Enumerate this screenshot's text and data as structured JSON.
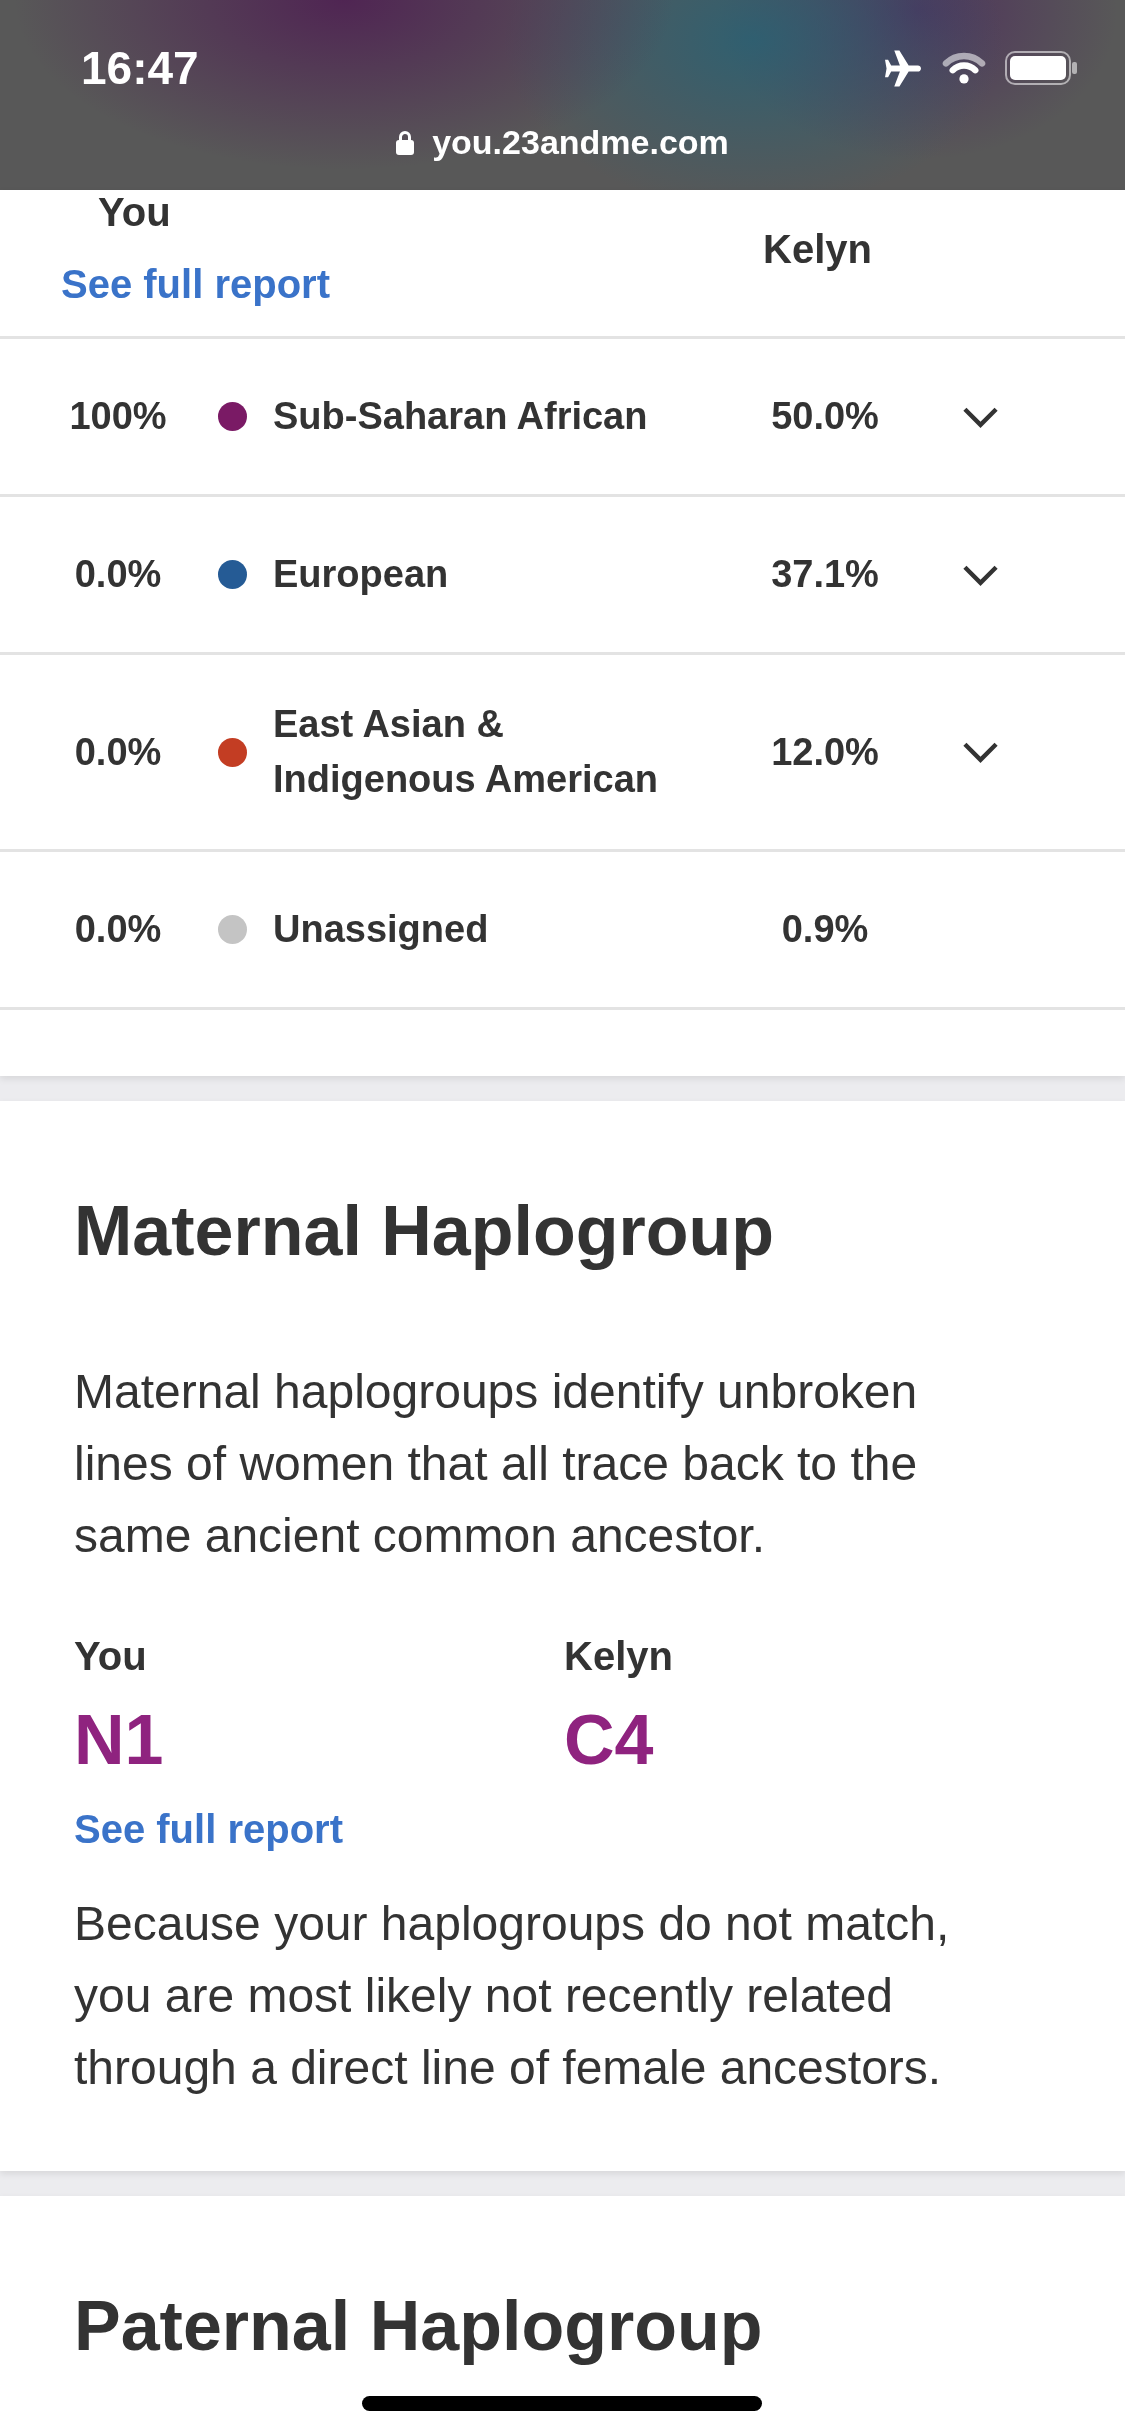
{
  "status_bar": {
    "time": "16:47",
    "url": "you.23andme.com"
  },
  "ancestry_table": {
    "columns": [
      {
        "label": "You",
        "link": "See full report"
      },
      {
        "label": "Kelyn"
      }
    ],
    "rows": [
      {
        "you": "100%",
        "color": "#7a1a65",
        "population": "Sub-Saharan African",
        "kelyn": "50.0%",
        "expandable": true,
        "expanded": false
      },
      {
        "you": "0.0%",
        "color": "#255b95",
        "population": "European",
        "kelyn": "37.1%",
        "expandable": true,
        "expanded": false
      },
      {
        "you": "0.0%",
        "color": "#c33d23",
        "population": "East Asian & Indigenous American",
        "kelyn": "12.0%",
        "expandable": true,
        "expanded": false
      },
      {
        "you": "0.0%",
        "color": "#c4c4c4",
        "population": "Unassigned",
        "kelyn": "0.9%",
        "expandable": false
      }
    ]
  },
  "maternal_haplogroup": {
    "title": "Maternal Haplogroup",
    "description": "Maternal haplogroups identify unbroken lines of women that all trace back to the same ancient common ancestor.",
    "people": [
      {
        "name": "You",
        "haplogroup": "N1",
        "link": "See full report"
      },
      {
        "name": "Kelyn",
        "haplogroup": "C4"
      }
    ],
    "conclusion": "Because your haplogroups do not match, you are most likely not recently related through a direct line of female ancestors."
  },
  "paternal_haplogroup": {
    "title": "Paternal Haplogroup"
  }
}
